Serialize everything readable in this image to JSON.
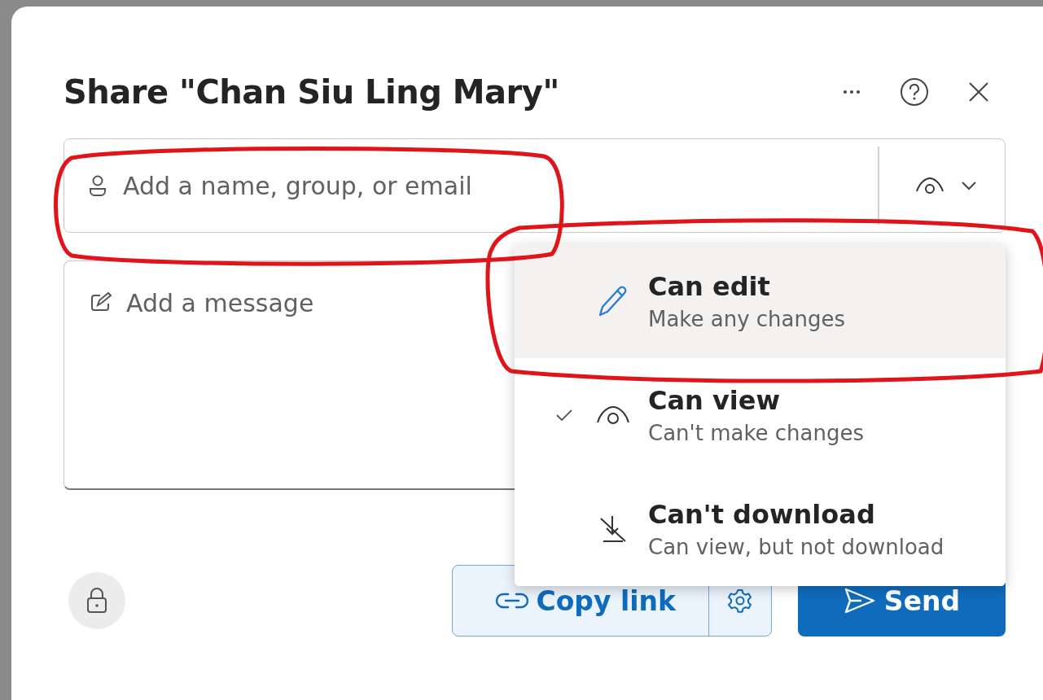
{
  "dialog": {
    "title": "Share \"Chan Siu Ling Mary\"",
    "recipient_field": {
      "placeholder": "Add a name, group, or email"
    },
    "message_field": {
      "placeholder": "Add a message"
    },
    "permission_menu": {
      "expanded": true,
      "items": [
        {
          "kind": "edit",
          "label": "Can edit",
          "description": "Make any changes",
          "selected": false,
          "highlighted": true
        },
        {
          "kind": "view",
          "label": "Can view",
          "description": "Can't make changes",
          "selected": true,
          "highlighted": false
        },
        {
          "kind": "nodownload",
          "label": "Can't download",
          "description": "Can view, but not download",
          "selected": false,
          "highlighted": false
        }
      ]
    },
    "copy_link_button": "Copy link",
    "send_button": "Send"
  }
}
